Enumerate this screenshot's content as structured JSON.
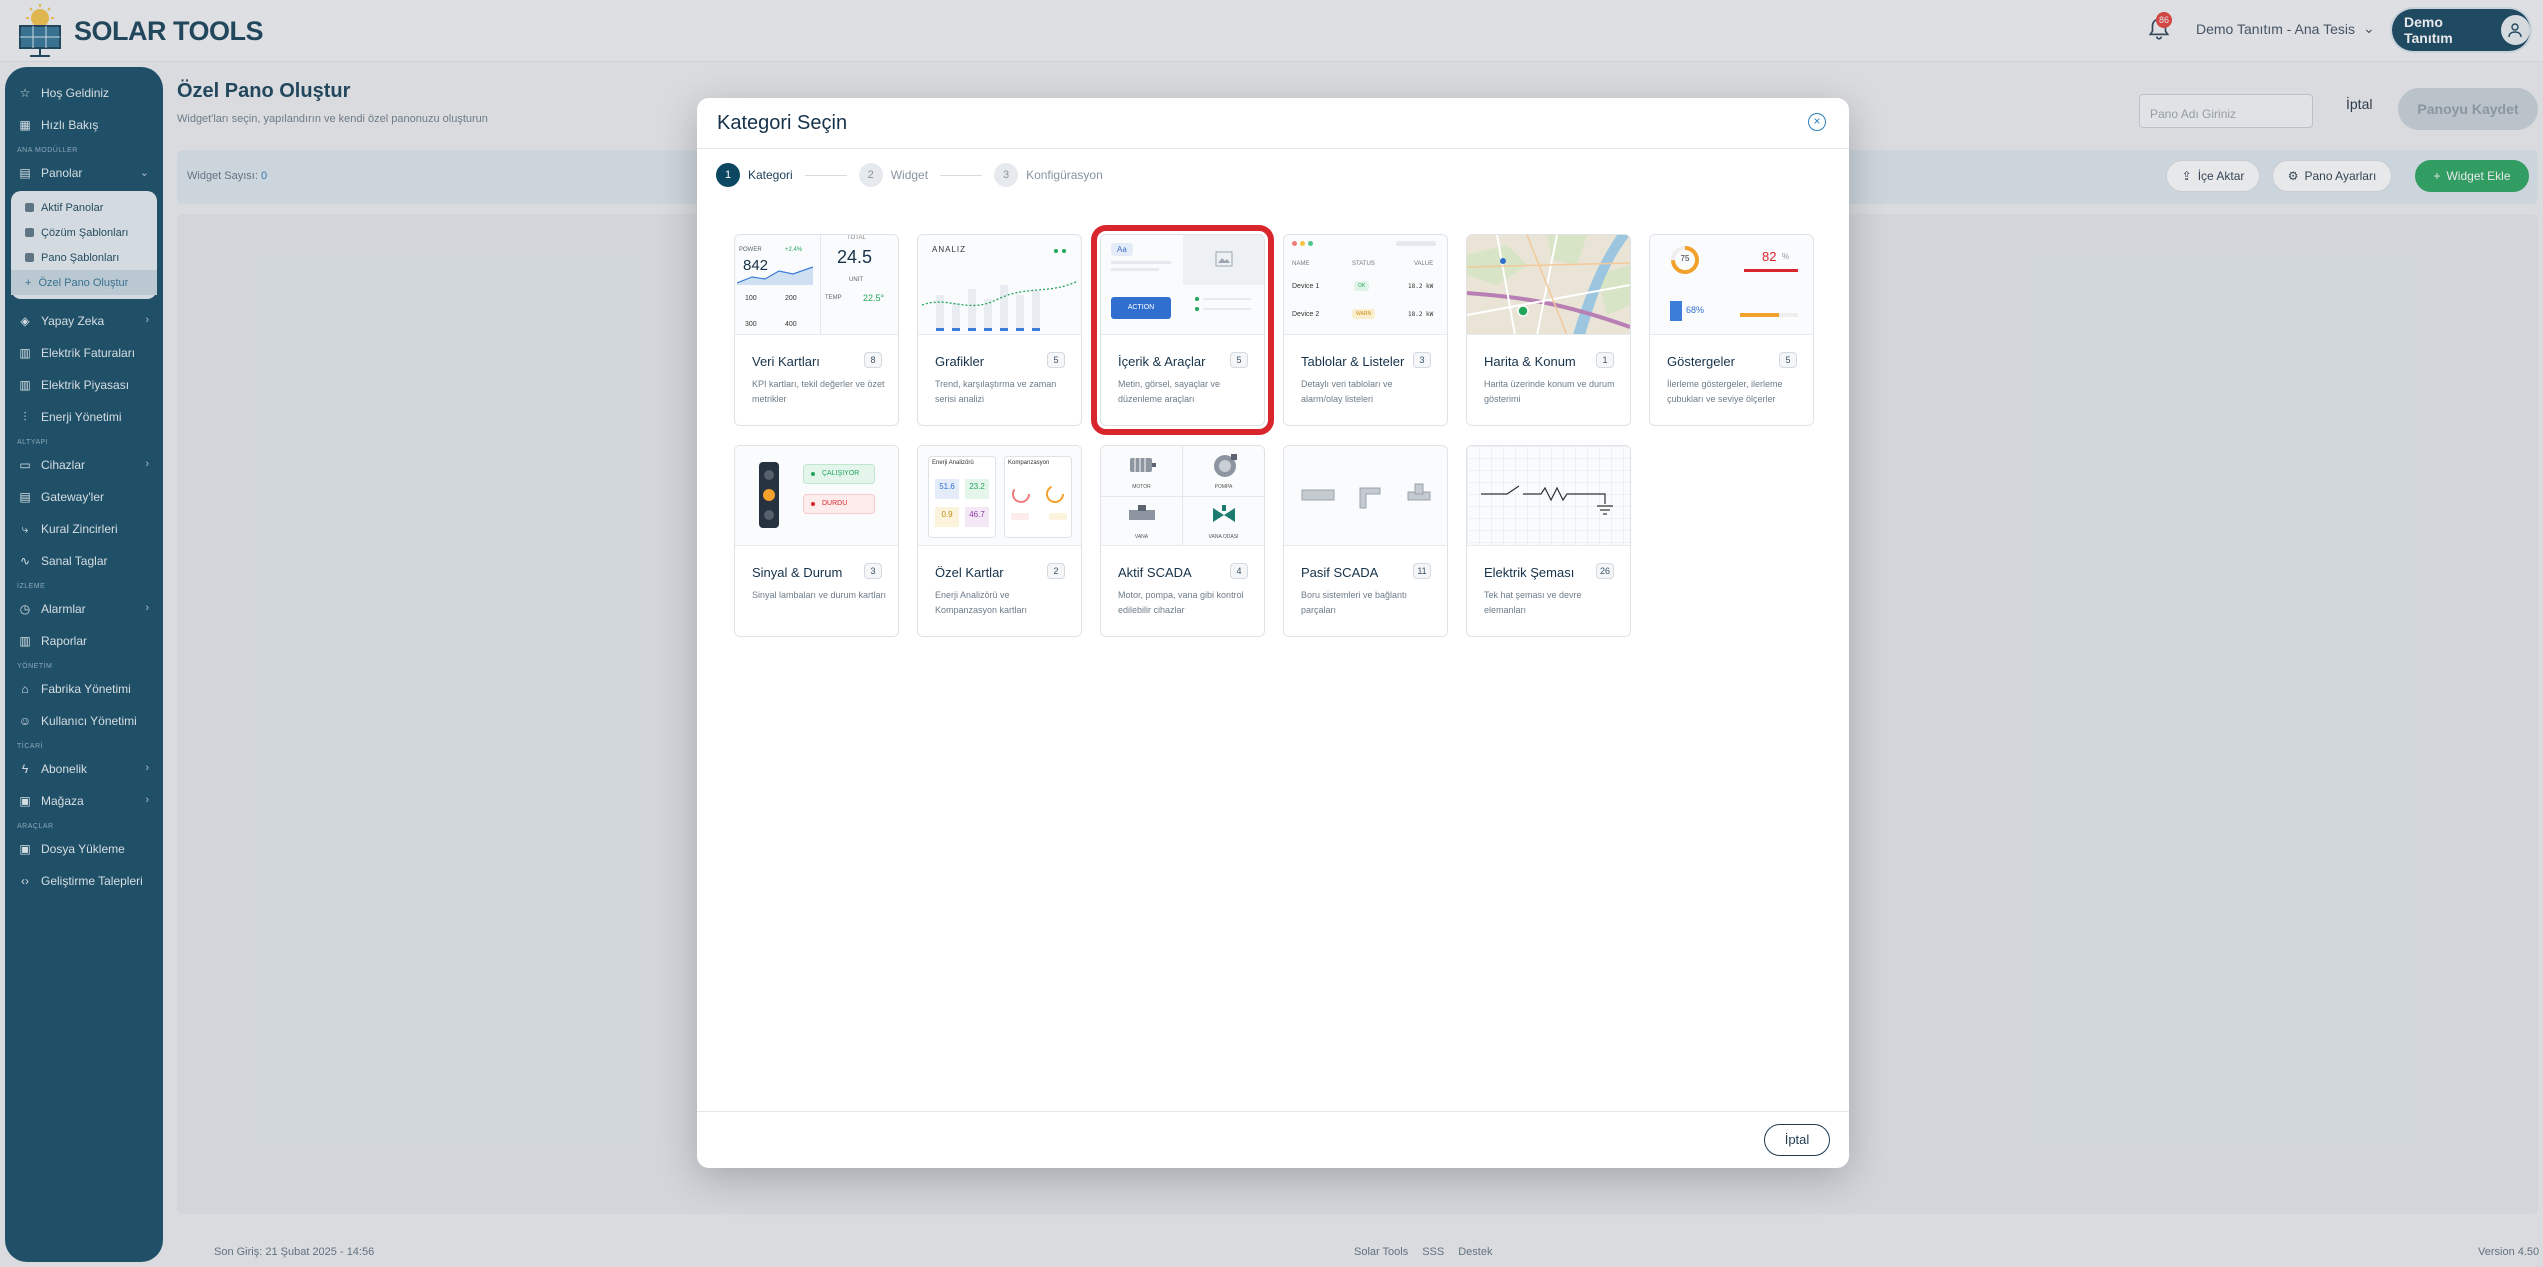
{
  "app": {
    "name": "SOLAR TOOLS"
  },
  "header": {
    "notification_count": "86",
    "tenant": "Demo Tanıtım - Ana Tesis",
    "user": "Demo Tanıtım"
  },
  "sidebar": {
    "top": [
      "Hoş Geldiniz",
      "Hızlı Bakış"
    ],
    "sec_ana": "ANA MODÜLLER",
    "panolar": "Panolar",
    "panolar_sub": [
      "Aktif Panolar",
      "Çözüm Şablonları",
      "Pano Şablonları",
      "Özel Pano Oluştur"
    ],
    "ana_items": [
      "Yapay Zeka",
      "Elektrik Faturaları",
      "Elektrik Piyasası",
      "Enerji Yönetimi"
    ],
    "sec_altyapi": "ALTYAPI",
    "altyapi_items": [
      "Cihazlar",
      "Gateway'ler",
      "Kural Zincirleri",
      "Sanal Taglar"
    ],
    "sec_izleme": "İZLEME",
    "izleme_items": [
      "Alarmlar",
      "Raporlar"
    ],
    "sec_yonetim": "YÖNETİM",
    "yonetim_items": [
      "Fabrika Yönetimi",
      "Kullanıcı Yönetimi"
    ],
    "sec_ticari": "TİCARİ",
    "ticari_items": [
      "Abonelik",
      "Mağaza"
    ],
    "sec_araclar": "ARAÇLAR",
    "araclar_items": [
      "Dosya Yükleme",
      "Geliştirme Talepleri"
    ]
  },
  "page": {
    "title": "Özel Pano Oluştur",
    "subtitle": "Widget'ları seçin, yapılandırın ve kendi özel panonuzu oluşturun",
    "name_placeholder": "Pano Adı Giriniz",
    "cancel": "İptal",
    "save": "Panoyu Kaydet",
    "widget_count_label": "Widget Sayısı:",
    "widget_count": "0",
    "import": "İçe Aktar",
    "settings": "Pano Ayarları",
    "add_widget": "Widget Ekle"
  },
  "footer": {
    "last_login": "Son Giriş: 21 Şubat 2025 - 14:56",
    "links": [
      "Solar Tools",
      "SSS",
      "Destek"
    ],
    "version": "Version 4.50"
  },
  "modal": {
    "title": "Kategori Seçin",
    "steps": [
      {
        "num": "1",
        "label": "Kategori"
      },
      {
        "num": "2",
        "label": "Widget"
      },
      {
        "num": "3",
        "label": "Konfigürasyon"
      }
    ],
    "cancel": "İptal",
    "categories": [
      {
        "title": "Veri Kartları",
        "count": "8",
        "desc": "KPI kartları, tekil değerler ve özet metrikler"
      },
      {
        "title": "Grafikler",
        "count": "5",
        "desc": "Trend, karşılaştırma ve zaman serisi analizi"
      },
      {
        "title": "İçerik & Araçlar",
        "count": "5",
        "desc": "Metin, görsel, sayaçlar ve düzenleme araçları"
      },
      {
        "title": "Tablolar & Listeler",
        "count": "3",
        "desc": "Detaylı veri tabloları ve alarm/olay listeleri"
      },
      {
        "title": "Harita & Konum",
        "count": "1",
        "desc": "Harita üzerinde konum ve durum gösterimi"
      },
      {
        "title": "Göstergeler",
        "count": "5",
        "desc": "İlerleme göstergeler, ilerleme çubukları ve seviye ölçerler"
      },
      {
        "title": "Sinyal & Durum",
        "count": "3",
        "desc": "Sinyal lambaları ve durum kartları"
      },
      {
        "title": "Özel Kartlar",
        "count": "2",
        "desc": "Enerji Analizörü ve Kompanzasyon kartları"
      },
      {
        "title": "Aktif SCADA",
        "count": "4",
        "desc": "Motor, pompa, vana gibi kontrol edilebilir cihazlar"
      },
      {
        "title": "Pasif SCADA",
        "count": "11",
        "desc": "Boru sistemleri ve bağlantı parçaları"
      },
      {
        "title": "Elektrik Şeması",
        "count": "26",
        "desc": "Tek hat şeması ve devre elemanları"
      }
    ],
    "thumbs": {
      "veri": {
        "power_label": "POWER",
        "power_value": "842",
        "power_delta": "+2.4%",
        "total_label": "TOTAL",
        "total_value": "24.5",
        "unit": "UNIT",
        "temp_label": "TEMP",
        "temp_value": "22.5°",
        "cells": [
          "100",
          "200",
          "300",
          "400"
        ]
      },
      "grafik": {
        "label": "ANALIZ"
      },
      "icerik": {
        "text_chip": "Aa",
        "action": "ACTION"
      },
      "tablo": {
        "headers": [
          "NAME",
          "STATUS",
          "VALUE"
        ],
        "rows": [
          {
            "name": "Device 1",
            "status": "OK",
            "value": "18.2 kW"
          },
          {
            "name": "Device 2",
            "status": "WARN",
            "value": "18.2 kW"
          }
        ]
      },
      "gosterge": {
        "ring": "75",
        "value": "82",
        "unit": "%",
        "pct": "68%"
      },
      "sinyal": {
        "running": "ÇALIŞIYOR",
        "stopped": "DURDU"
      },
      "ozel": {
        "left_title": "Enerji Analizörü",
        "right_title": "Kompanzasyon",
        "values": [
          "51.6",
          "23.2",
          "0.9",
          "46.7"
        ]
      },
      "scada": {
        "labels": [
          "MOTOR",
          "POMPA",
          "VANA",
          "VANA ODASI"
        ]
      }
    }
  }
}
